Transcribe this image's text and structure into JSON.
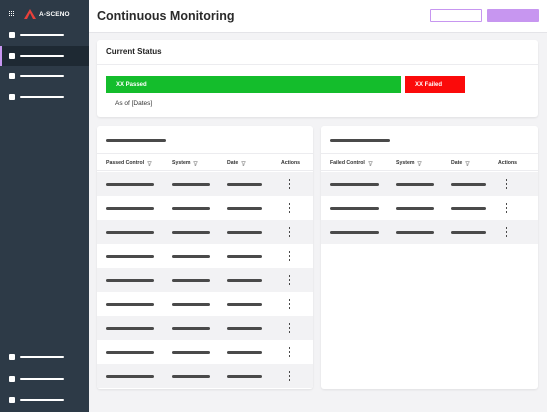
{
  "brand": {
    "name": "A-SCENO"
  },
  "sidebar": {
    "items": [
      {
        "id": "nav-1"
      },
      {
        "id": "nav-2"
      },
      {
        "id": "nav-3"
      },
      {
        "id": "nav-4"
      },
      {
        "id": "nav-bottom-1"
      },
      {
        "id": "nav-bottom-2"
      },
      {
        "id": "nav-bottom-3"
      }
    ],
    "active_index": 1
  },
  "header": {
    "title": "Continuous Monitoring"
  },
  "status": {
    "title": "Current Status",
    "passed_label": "XX Passed",
    "failed_label": "XX Failed",
    "as_of": "As of [Dates]"
  },
  "passed_table": {
    "columns": {
      "control": "Passed Control",
      "system": "System",
      "date": "Date",
      "actions": "Actions"
    },
    "row_count": 9
  },
  "failed_table": {
    "columns": {
      "control": "Failed Control",
      "system": "System",
      "date": "Date",
      "actions": "Actions"
    },
    "row_count": 3
  },
  "colors": {
    "sidebar": "#2d3a47",
    "accent": "#c796f0",
    "passed": "#14bd2c",
    "failed": "#fb0a0a"
  },
  "icons": [
    "apps-grid-icon",
    "logo-icon",
    "filter-icon",
    "kebab-menu-icon"
  ]
}
